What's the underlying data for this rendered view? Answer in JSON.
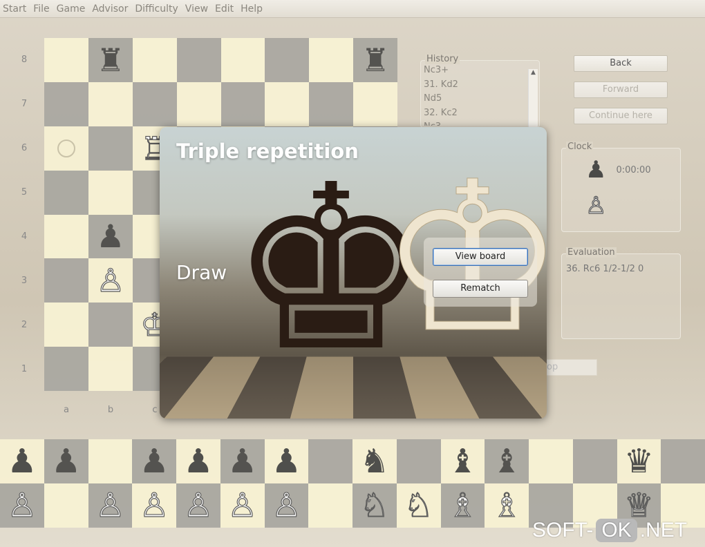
{
  "menu": [
    "Start",
    "File",
    "Game",
    "Advisor",
    "Difficulty",
    "View",
    "Edit",
    "Help"
  ],
  "board": {
    "ranks": [
      "8",
      "7",
      "6",
      "5",
      "4",
      "3",
      "2",
      "1"
    ],
    "files": [
      "a",
      "b",
      "c"
    ],
    "pieces": [
      {
        "square": "b8",
        "glyph": "♜",
        "color": "black",
        "name": "black-rook"
      },
      {
        "square": "h8",
        "glyph": "♜",
        "color": "black",
        "name": "black-rook"
      },
      {
        "square": "c6",
        "glyph": "♖",
        "color": "white",
        "name": "white-rook"
      },
      {
        "square": "b4",
        "glyph": "♟",
        "color": "black",
        "name": "black-pawn"
      },
      {
        "square": "b3",
        "glyph": "♙",
        "color": "white",
        "name": "white-pawn"
      },
      {
        "square": "c2",
        "glyph": "♔",
        "color": "white",
        "name": "white-king"
      }
    ],
    "marker_square": "a6"
  },
  "captured": {
    "top": [
      "♟",
      "♟",
      "",
      "♟",
      "♟",
      "♟",
      "♟",
      "",
      "♞",
      "",
      "♝",
      "♝",
      "",
      "",
      "♛",
      ""
    ],
    "bottom": [
      "♙",
      "",
      "♙",
      "♙",
      "♙",
      "♙",
      "♙",
      "",
      "♘",
      "♘",
      "♗",
      "♗",
      "",
      "",
      "♕",
      ""
    ]
  },
  "history": {
    "title": "History",
    "moves": [
      "Nc3+",
      "31. Kd2",
      "Nd5",
      "32. Kc2",
      "Nc3"
    ]
  },
  "nav": {
    "back": "Back",
    "forward": "Forward",
    "continue": "Continue here"
  },
  "clock": {
    "title": "Clock",
    "black_time": "0:00:00"
  },
  "evaluation": {
    "title": "Evaluation",
    "text": "36. Rc6 1/2-1/2 0"
  },
  "stop_label": "op",
  "dialog": {
    "title": "Triple repetition",
    "result": "Draw",
    "view_board": "View board",
    "rematch": "Rematch"
  },
  "watermark": {
    "left": "SOFT-",
    "mid": "OK",
    "right": ".NET"
  },
  "colors": {
    "light_square": "#f7f1d3",
    "dark_square": "#a9a7a0",
    "focus_blue": "#3a6fb5"
  }
}
